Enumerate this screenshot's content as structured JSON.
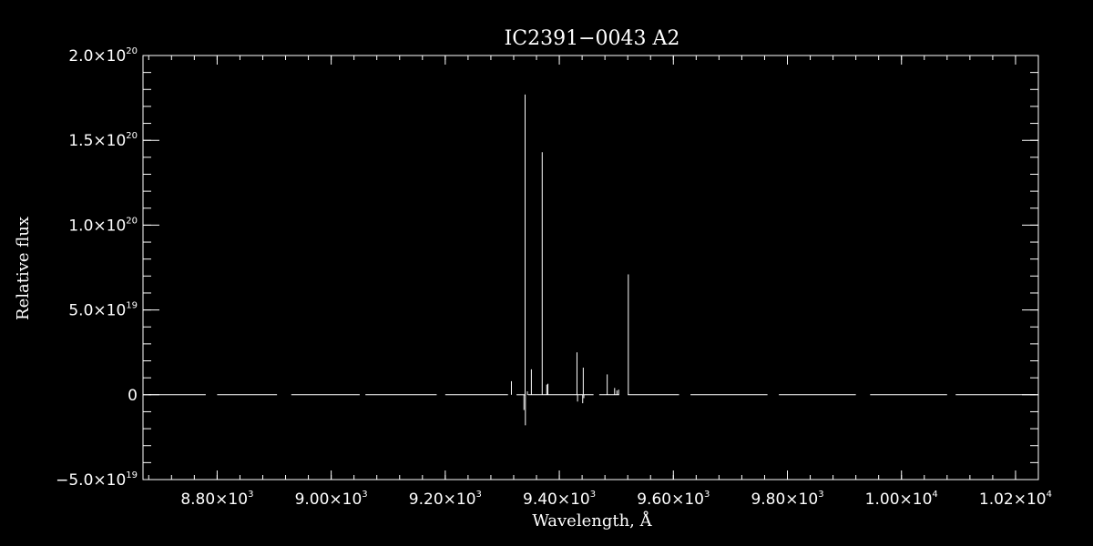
{
  "chart_data": {
    "type": "line",
    "title": "IC2391−0043  A2",
    "xlabel": "Wavelength, Å",
    "ylabel": "Relative flux",
    "xlim": [
      8670,
      10240
    ],
    "ylim": [
      -5e+19,
      2e+20
    ],
    "grid": false,
    "colors": {
      "background": "#000000",
      "foreground": "#ffffff",
      "line": "#ffffff"
    },
    "x_ticks": [
      {
        "value": 8800,
        "mant": "8.80×10",
        "exp": "3"
      },
      {
        "value": 9000,
        "mant": "9.00×10",
        "exp": "3"
      },
      {
        "value": 9200,
        "mant": "9.20×10",
        "exp": "3"
      },
      {
        "value": 9400,
        "mant": "9.40×10",
        "exp": "3"
      },
      {
        "value": 9600,
        "mant": "9.60×10",
        "exp": "3"
      },
      {
        "value": 9800,
        "mant": "9.80×10",
        "exp": "3"
      },
      {
        "value": 10000,
        "mant": "1.00×10",
        "exp": "4"
      },
      {
        "value": 10200,
        "mant": "1.02×10",
        "exp": "4"
      }
    ],
    "y_ticks": [
      {
        "value": -5e+19,
        "mant": "−5.0×10",
        "exp": "19"
      },
      {
        "value": 0,
        "mant": "0",
        "exp": ""
      },
      {
        "value": 5e+19,
        "mant": "5.0×10",
        "exp": "19"
      },
      {
        "value": 1e+20,
        "mant": "1.0×10",
        "exp": "20"
      },
      {
        "value": 1.5e+20,
        "mant": "1.5×10",
        "exp": "20"
      },
      {
        "value": 2e+20,
        "mant": "2.0×10",
        "exp": "20"
      }
    ],
    "x_minor_step": 40,
    "y_minor_step": 1e+19,
    "baseline_segments": [
      [
        8680,
        8780
      ],
      [
        8800,
        8905
      ],
      [
        8930,
        9050
      ],
      [
        9060,
        9185
      ],
      [
        9200,
        9310
      ],
      [
        9325,
        9340
      ],
      [
        9345,
        9460
      ],
      [
        9470,
        9505
      ],
      [
        9520,
        9610
      ],
      [
        9630,
        9765
      ],
      [
        9785,
        9920
      ],
      [
        9945,
        10080
      ],
      [
        10095,
        10235
      ]
    ],
    "spikes": [
      {
        "x": 9316,
        "y": 8e+18
      },
      {
        "x": 9338,
        "y": -9e+18
      },
      {
        "x": 9340,
        "y": 1.77e+20
      },
      {
        "x": 9340.5,
        "y": -1.8e+19
      },
      {
        "x": 9344,
        "y": 2e+18
      },
      {
        "x": 9351,
        "y": 1.5e+19
      },
      {
        "x": 9370,
        "y": 1.43e+20
      },
      {
        "x": 9378,
        "y": 6e+18
      },
      {
        "x": 9380,
        "y": 6.5e+18
      },
      {
        "x": 9431,
        "y": 2.5e+19
      },
      {
        "x": 9432,
        "y": -4e+18
      },
      {
        "x": 9441,
        "y": -5e+18
      },
      {
        "x": 9442,
        "y": 1.6e+19
      },
      {
        "x": 9443,
        "y": -2e+18
      },
      {
        "x": 9484,
        "y": 1.2e+19
      },
      {
        "x": 9497,
        "y": 4e+18
      },
      {
        "x": 9501,
        "y": 2.5e+18
      },
      {
        "x": 9504,
        "y": 3e+18
      },
      {
        "x": 9521,
        "y": 7.1e+19
      }
    ]
  }
}
